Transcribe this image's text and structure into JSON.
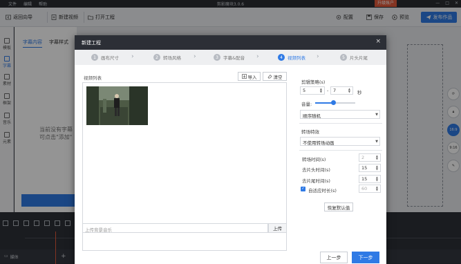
{
  "titlebar": {
    "menu": [
      "文件",
      "编辑",
      "帮助"
    ],
    "title": "剪影魔块3.0.6",
    "upgrade": "升级账户",
    "window_controls": [
      "—",
      "□",
      "✕"
    ]
  },
  "toolbar": {
    "back": "返回向导",
    "new_video": "新建视频",
    "open_project": "打开工程",
    "config": "配置",
    "save": "保存",
    "preview": "预览",
    "publish": "发布作品"
  },
  "left_rail": {
    "items": [
      "模板",
      "字幕",
      "素材",
      "框架",
      "音乐",
      "元素"
    ]
  },
  "left_panel": {
    "tabs": [
      "字幕内容",
      "字幕样式"
    ],
    "empty_hint_line1": "当前没有字幕",
    "empty_hint_line2": "可点击\"添加\""
  },
  "right_rail": {
    "labels": [
      "16:9",
      "9:16"
    ]
  },
  "timeline": {
    "media_label": "媒体"
  },
  "dialog": {
    "title": "新建工程",
    "close": "×",
    "steps": [
      {
        "num": "1",
        "label": "画布尺寸"
      },
      {
        "num": "2",
        "label": "转场风格"
      },
      {
        "num": "3",
        "label": "字幕&配音"
      },
      {
        "num": "4",
        "label": "视频列表"
      },
      {
        "num": "5",
        "label": "片头片尾"
      }
    ],
    "active_step": 4,
    "video_list_label": "视频列表",
    "import_btn": "导入",
    "clear_btn": "清空",
    "bg_music_placeholder": "上传背景音乐",
    "upload_btn": "上传",
    "settings": {
      "clip_strategy_label": "剪辑策略(s)",
      "clip_min": "5",
      "clip_max": "7",
      "clip_sep": "-",
      "clip_unit": "秒",
      "volume_label": "音量:",
      "volume_level": 0.45,
      "order_value": "顺序随机",
      "transition_label": "转场特效",
      "transition_value": "不使用转场动画",
      "transition_time_label": "转场时间(s)",
      "transition_time": "2",
      "trim_head_label": "去片头时间(s)",
      "trim_head": "15",
      "trim_tail_label": "去片尾时间(s)",
      "trim_tail": "15",
      "auto_duration_label": "自适应时长(s)",
      "auto_duration": "60",
      "auto_duration_checked": true,
      "reset_btn": "恢复默认值"
    },
    "prev_btn": "上一步",
    "next_btn": "下一步"
  },
  "colors": {
    "accent": "#2f7ae5",
    "upgrade": "#e45a3b",
    "dialog_header": "#2c2f36"
  }
}
